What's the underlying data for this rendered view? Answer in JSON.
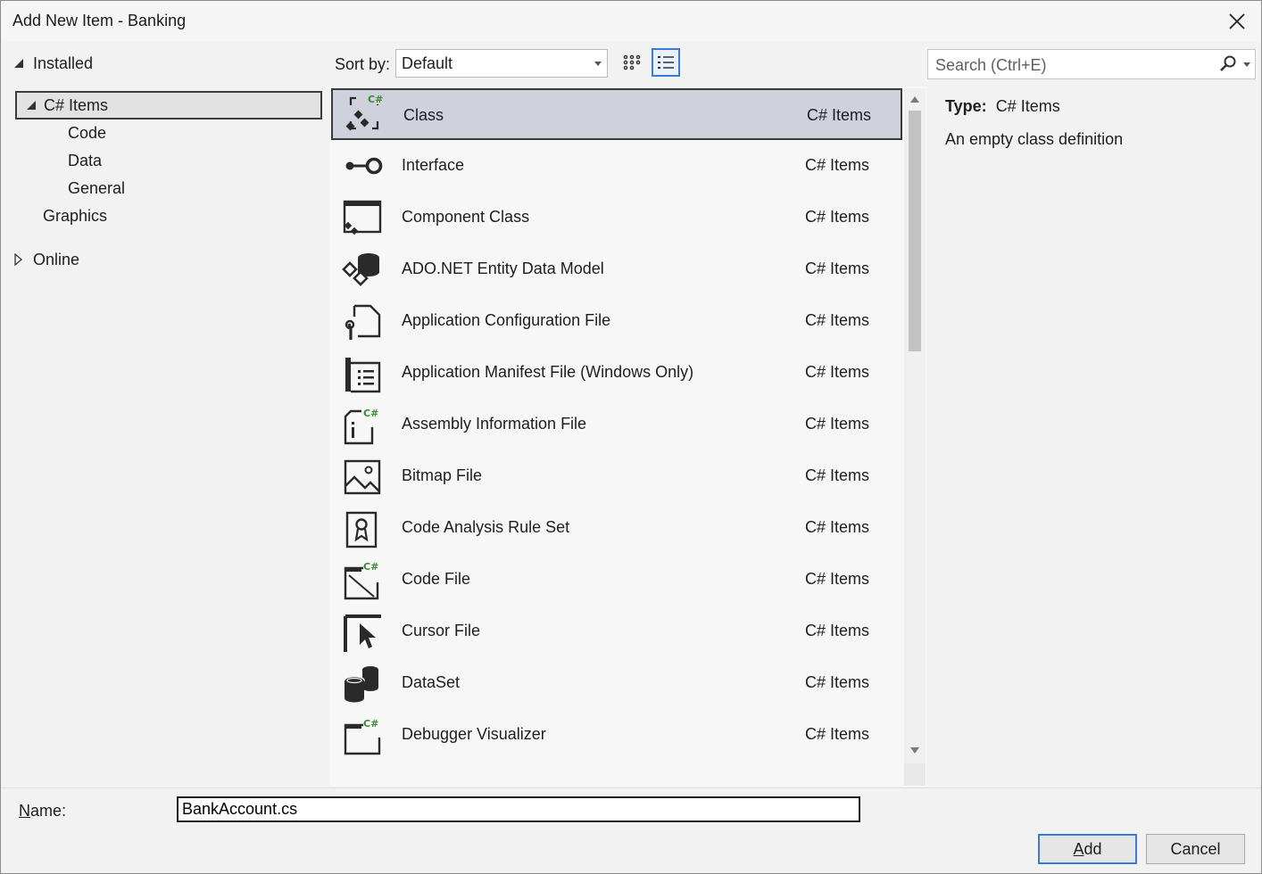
{
  "window": {
    "title": "Add New Item - Banking"
  },
  "tree": {
    "installed_label": "Installed",
    "csharp_items_label": "C# Items",
    "children": [
      "Code",
      "Data",
      "General"
    ],
    "graphics_label": "Graphics",
    "online_label": "Online"
  },
  "toolbar": {
    "sort_label": "Sort by:",
    "sort_value": "Default",
    "search_placeholder": "Search (Ctrl+E)"
  },
  "items": [
    {
      "name": "Class",
      "category": "C# Items",
      "icon": "class-icon",
      "selected": true
    },
    {
      "name": "Interface",
      "category": "C# Items",
      "icon": "interface-icon"
    },
    {
      "name": "Component Class",
      "category": "C# Items",
      "icon": "component-class-icon"
    },
    {
      "name": "ADO.NET Entity Data Model",
      "category": "C# Items",
      "icon": "entity-model-icon"
    },
    {
      "name": "Application Configuration File",
      "category": "C# Items",
      "icon": "config-file-icon"
    },
    {
      "name": "Application Manifest File (Windows Only)",
      "category": "C# Items",
      "icon": "manifest-file-icon"
    },
    {
      "name": "Assembly Information File",
      "category": "C# Items",
      "icon": "assembly-info-icon"
    },
    {
      "name": "Bitmap File",
      "category": "C# Items",
      "icon": "bitmap-file-icon"
    },
    {
      "name": "Code Analysis Rule Set",
      "category": "C# Items",
      "icon": "rule-set-icon"
    },
    {
      "name": "Code File",
      "category": "C# Items",
      "icon": "code-file-icon"
    },
    {
      "name": "Cursor File",
      "category": "C# Items",
      "icon": "cursor-file-icon"
    },
    {
      "name": "DataSet",
      "category": "C# Items",
      "icon": "dataset-icon"
    },
    {
      "name": "Debugger Visualizer",
      "category": "C# Items",
      "icon": "debugger-visualizer-icon"
    }
  ],
  "details": {
    "type_label": "Type:",
    "type_value": "C# Items",
    "description": "An empty class definition"
  },
  "footer": {
    "name_label_prefix": "N",
    "name_label_rest": "ame:",
    "name_value": "BankAccount.cs",
    "add_prefix": "A",
    "add_rest": "dd",
    "cancel_label": "Cancel"
  },
  "colors": {
    "accent": "#3a7bd5",
    "selection": "#cfd2dc",
    "csharp_badge": "#388a34"
  }
}
